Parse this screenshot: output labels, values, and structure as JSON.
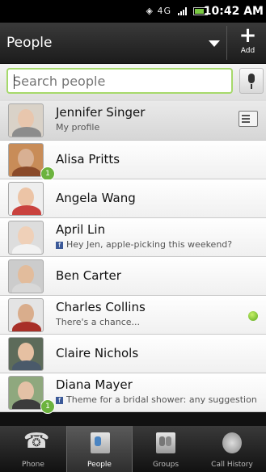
{
  "status": {
    "time": "10:42 AM",
    "network": "4G"
  },
  "header": {
    "title": "People",
    "add_label": "Add"
  },
  "search": {
    "placeholder": "Search people"
  },
  "contacts": [
    {
      "name": "Jennifer Singer",
      "subtitle": "My profile",
      "fb": false,
      "face": "#e8c6ad",
      "body": "#8c8c8c",
      "bg": "#d9d2c8",
      "badge": "",
      "online": false,
      "me": true
    },
    {
      "name": "Alisa Pritts",
      "subtitle": "",
      "fb": false,
      "face": "#d8b093",
      "body": "#8a4a2a",
      "bg": "#c88c58",
      "badge": "1",
      "online": false
    },
    {
      "name": "Angela Wang",
      "subtitle": "",
      "fb": false,
      "face": "#ecc4a6",
      "body": "#c9423e",
      "bg": "#eee",
      "badge": "",
      "online": false
    },
    {
      "name": "April Lin",
      "subtitle": "Hey Jen, apple-picking this weekend?",
      "fb": true,
      "face": "#efd0b8",
      "body": "#f2f2f2",
      "bg": "#ddd",
      "badge": "",
      "online": false
    },
    {
      "name": "Ben Carter",
      "subtitle": "",
      "fb": false,
      "face": "#e2bc9c",
      "body": "#d8d8d8",
      "bg": "#ccc",
      "badge": "",
      "online": false
    },
    {
      "name": "Charles Collins",
      "subtitle": "There's a chance...",
      "fb": false,
      "face": "#d9ad8c",
      "body": "#a82f28",
      "bg": "#e4e4e4",
      "badge": "",
      "online": true
    },
    {
      "name": "Claire Nichols",
      "subtitle": "",
      "fb": false,
      "face": "#e6c0a2",
      "body": "#4a5a6a",
      "bg": "#5d6b5a",
      "badge": "",
      "online": false
    },
    {
      "name": "Diana Mayer",
      "subtitle": "Theme for a bridal shower: any suggestion",
      "fb": true,
      "face": "#e4c1a6",
      "body": "#3c3c3c",
      "bg": "#8fa87e",
      "badge": "1",
      "online": false
    }
  ],
  "tabs": [
    {
      "label": "Phone",
      "icon": "phone-icon",
      "active": false
    },
    {
      "label": "People",
      "icon": "people-icon",
      "active": true
    },
    {
      "label": "Groups",
      "icon": "groups-icon",
      "active": false
    },
    {
      "label": "Call History",
      "icon": "call-history-icon",
      "active": false
    }
  ]
}
